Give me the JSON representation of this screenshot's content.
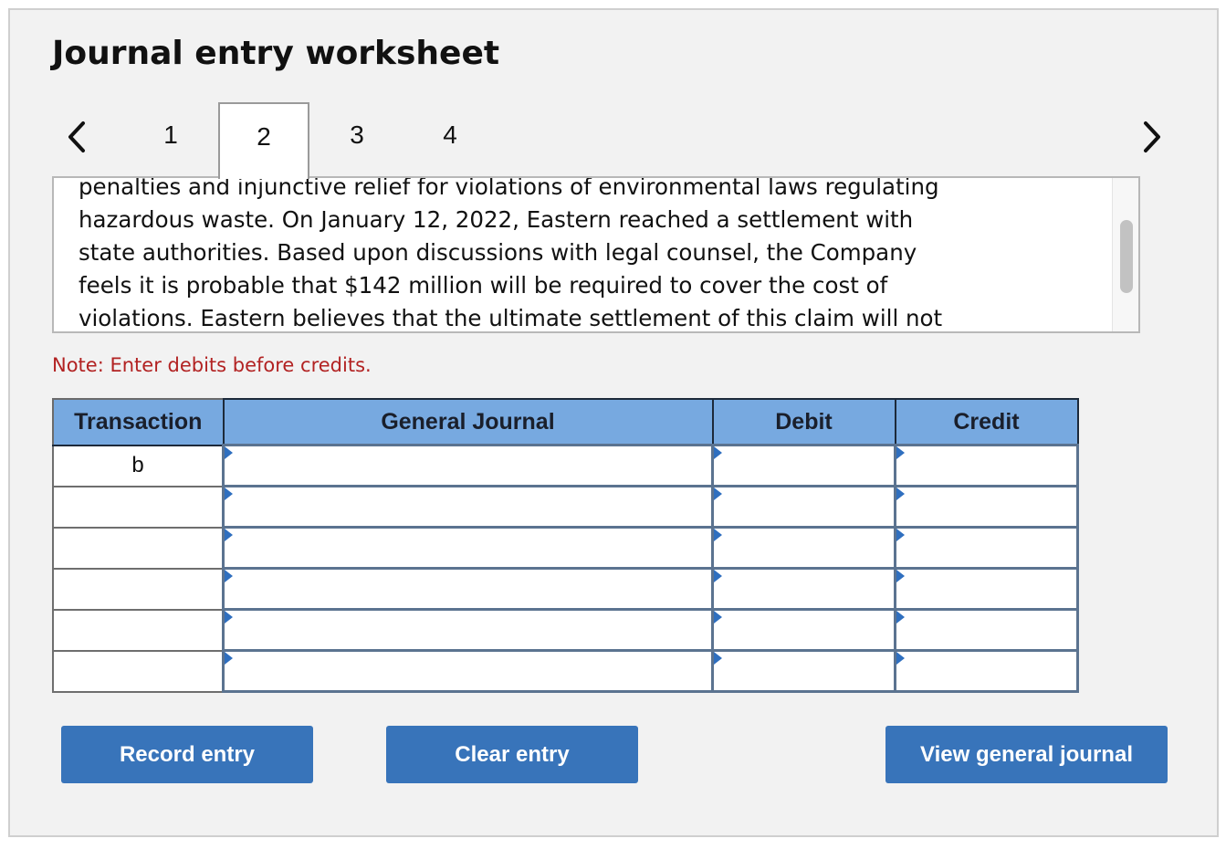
{
  "worksheet": {
    "title": "Journal entry worksheet",
    "prev_icon": "chevron-left-icon",
    "next_icon": "chevron-right-icon",
    "tabs": [
      {
        "label": "1",
        "active": false
      },
      {
        "label": "2",
        "active": true
      },
      {
        "label": "3",
        "active": false
      },
      {
        "label": "4",
        "active": false
      }
    ],
    "problem_text_lines": [
      "penalties and injunctive relief for violations of environmental laws regulating",
      "hazardous waste. On January 12, 2022, Eastern reached a settlement with",
      "state authorities. Based upon discussions with legal counsel, the Company",
      "feels it is probable that $142 million will be required to cover the cost of",
      "violations. Eastern believes that the ultimate settlement of this claim will not"
    ],
    "note": "Note: Enter debits before credits."
  },
  "journal": {
    "columns": [
      "Transaction",
      "General Journal",
      "Debit",
      "Credit"
    ],
    "rows": [
      {
        "transaction": "b",
        "account": "",
        "debit": "",
        "credit": ""
      },
      {
        "transaction": "",
        "account": "",
        "debit": "",
        "credit": ""
      },
      {
        "transaction": "",
        "account": "",
        "debit": "",
        "credit": ""
      },
      {
        "transaction": "",
        "account": "",
        "debit": "",
        "credit": ""
      },
      {
        "transaction": "",
        "account": "",
        "debit": "",
        "credit": ""
      },
      {
        "transaction": "",
        "account": "",
        "debit": "",
        "credit": ""
      }
    ]
  },
  "buttons": {
    "record_entry": "Record entry",
    "clear_entry": "Clear entry",
    "view_general_journal": "View general journal"
  },
  "colors": {
    "header_blue": "#77a9e0",
    "button_blue": "#3874ba",
    "note_red": "#b22222",
    "panel_bg": "#f2f2f2"
  }
}
